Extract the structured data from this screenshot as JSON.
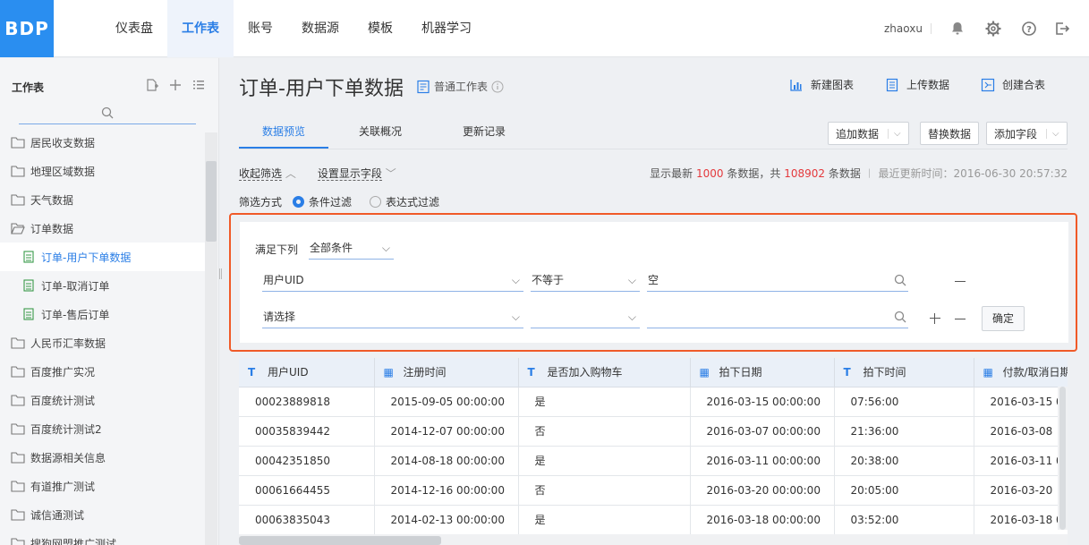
{
  "app": {
    "logo": "BDP",
    "accent": "#2a7ee6",
    "highlight": "#f05a28"
  },
  "nav": {
    "items": [
      {
        "label": "仪表盘"
      },
      {
        "label": "工作表",
        "active": true
      },
      {
        "label": "账号"
      },
      {
        "label": "数据源"
      },
      {
        "label": "模板"
      },
      {
        "label": "机器学习"
      }
    ],
    "user": "zhaoxu",
    "icons": [
      "bell-icon",
      "gear-icon",
      "help-icon",
      "logout-icon"
    ]
  },
  "sidebar": {
    "title": "工作表",
    "tree": [
      {
        "label": "居民收支数据",
        "type": "folder"
      },
      {
        "label": "地理区域数据",
        "type": "folder"
      },
      {
        "label": "天气数据",
        "type": "folder"
      },
      {
        "label": "订单数据",
        "type": "folder-open"
      },
      {
        "label": "订单-用户下单数据",
        "type": "sheet",
        "active": true
      },
      {
        "label": "订单-取消订单",
        "type": "sheet"
      },
      {
        "label": "订单-售后订单",
        "type": "sheet"
      },
      {
        "label": "人民币汇率数据",
        "type": "folder"
      },
      {
        "label": "百度推广实况",
        "type": "folder"
      },
      {
        "label": "百度统计测试",
        "type": "folder"
      },
      {
        "label": "百度统计测试2",
        "type": "folder"
      },
      {
        "label": "数据源相关信息",
        "type": "folder"
      },
      {
        "label": "有道推广测试",
        "type": "folder"
      },
      {
        "label": "诚信通测试",
        "type": "folder"
      },
      {
        "label": "搜狗网盟推广测试",
        "type": "folder"
      }
    ]
  },
  "header": {
    "title": "订单-用户下单数据",
    "sheet_type": "普通工作表",
    "actions": {
      "new_chart": "新建图表",
      "upload": "上传数据",
      "merge": "创建合表"
    }
  },
  "tabs": [
    {
      "label": "数据预览",
      "active": true
    },
    {
      "label": "关联概况"
    },
    {
      "label": "更新记录"
    }
  ],
  "toolbar": {
    "append": "追加数据",
    "replace": "替换数据",
    "add_field": "添加字段"
  },
  "filters": {
    "collapse": "收起筛选",
    "set_fields": "设置显示字段",
    "info_prefix": "显示最新",
    "shown": "1000",
    "info_mid": "条数据，共",
    "total": "108902",
    "info_suffix": "条数据",
    "updated": "最近更新时间：2016-06-30 20:57:32",
    "mode_label": "筛选方式",
    "mode_condition": "条件过滤",
    "mode_expression": "表达式过滤",
    "match_label": "满足下列",
    "match_value": "全部条件",
    "row1": {
      "field": "用户UID",
      "op": "不等于",
      "value": "空"
    },
    "row2": {
      "field": "请选择",
      "op": "",
      "value": ""
    },
    "ok": "确定"
  },
  "table": {
    "columns": [
      {
        "label": "用户UID",
        "type": "text"
      },
      {
        "label": "注册时间",
        "type": "date"
      },
      {
        "label": "是否加入购物车",
        "type": "text"
      },
      {
        "label": "拍下日期",
        "type": "date"
      },
      {
        "label": "拍下时间",
        "type": "text"
      },
      {
        "label": "付款/取消日期",
        "type": "date"
      }
    ],
    "rows": [
      [
        "00023889818",
        "2015-09-05 00:00:00",
        "是",
        "2016-03-15 00:00:00",
        "07:56:00",
        "2016-03-15 0"
      ],
      [
        "00035839442",
        "2014-12-07 00:00:00",
        "否",
        "2016-03-07 00:00:00",
        "21:36:00",
        "2016-03-08"
      ],
      [
        "00042351850",
        "2014-08-18 00:00:00",
        "是",
        "2016-03-11 00:00:00",
        "20:38:00",
        "2016-03-11 0"
      ],
      [
        "00061664455",
        "2014-12-16 00:00:00",
        "否",
        "2016-03-20 00:00:00",
        "20:05:00",
        "2016-03-20"
      ],
      [
        "00063835043",
        "2014-02-13 00:00:00",
        "是",
        "2016-03-18 00:00:00",
        "03:52:00",
        "2016-03-18 0"
      ]
    ]
  }
}
